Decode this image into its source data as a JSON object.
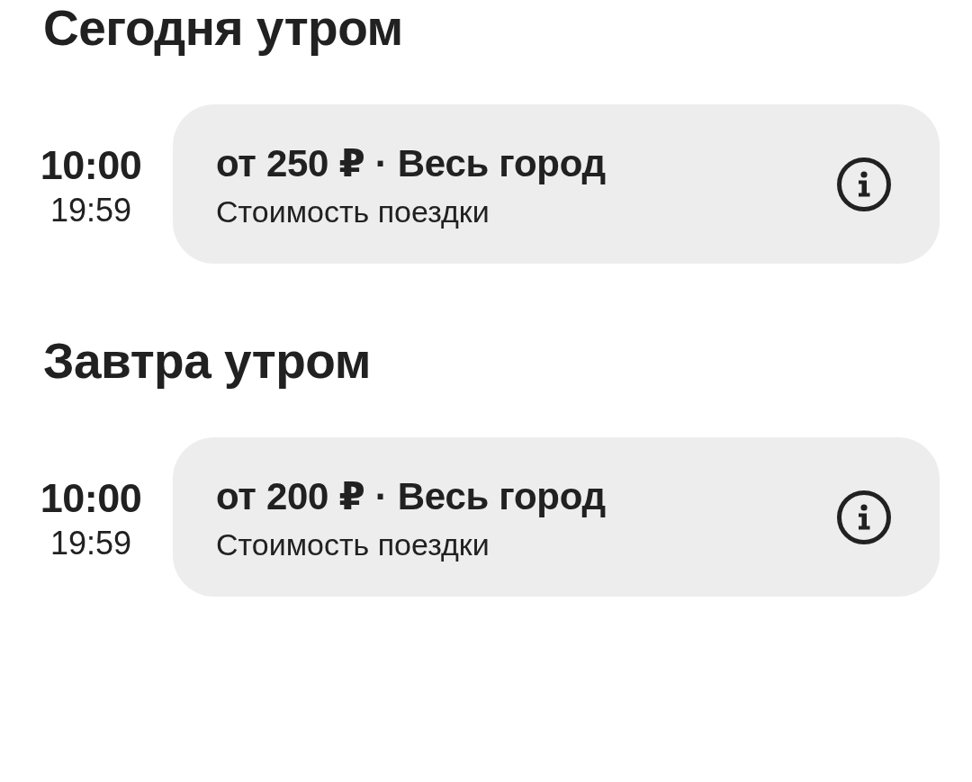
{
  "sections": [
    {
      "title": "Сегодня утром",
      "slots": [
        {
          "start_time": "10:00",
          "end_time": "19:59",
          "price": "от 250 ₽ · Весь город",
          "caption": "Стоимость поездки"
        }
      ]
    },
    {
      "title": "Завтра утром",
      "slots": [
        {
          "start_time": "10:00",
          "end_time": "19:59",
          "price": "от 200 ₽ · Весь город",
          "caption": "Стоимость поездки"
        }
      ]
    }
  ]
}
